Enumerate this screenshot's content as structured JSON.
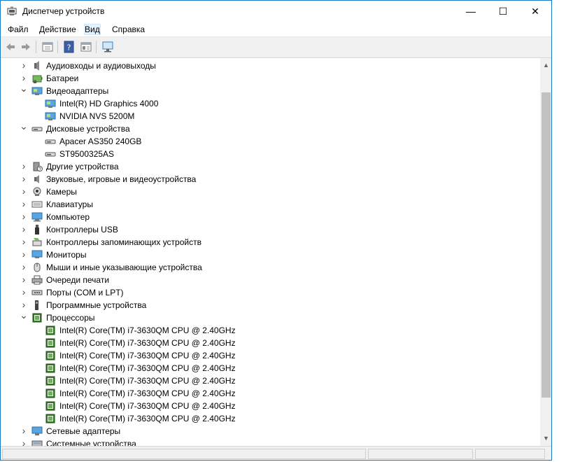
{
  "window": {
    "title": "Диспетчер устройств",
    "minimize": "—",
    "maximize": "☐",
    "close": "✕"
  },
  "menu": [
    {
      "label": "Файл"
    },
    {
      "label": "Действие"
    },
    {
      "label": "Вид"
    },
    {
      "label": "Справка"
    }
  ],
  "toolbar": {
    "buttons": [
      "back-icon",
      "forward-icon",
      "properties-icon",
      "help-icon",
      "view-icon",
      "scan-hardware-icon"
    ]
  },
  "tree": [
    {
      "label": "Аудиовходы и аудиовыходы",
      "level": 0,
      "state": "collapsed",
      "icon": "audio-io-icon"
    },
    {
      "label": "Батареи",
      "level": 0,
      "state": "collapsed",
      "icon": "battery-icon"
    },
    {
      "label": "Видеоадаптеры",
      "level": 0,
      "state": "expanded",
      "icon": "display-adapter-icon"
    },
    {
      "label": "Intel(R) HD Graphics 4000",
      "level": 1,
      "state": "none",
      "icon": "display-adapter-icon"
    },
    {
      "label": "NVIDIA NVS 5200M",
      "level": 1,
      "state": "none",
      "icon": "display-adapter-icon"
    },
    {
      "label": "Дисковые устройства",
      "level": 0,
      "state": "expanded",
      "icon": "disk-drive-icon"
    },
    {
      "label": "Apacer AS350 240GB",
      "level": 1,
      "state": "none",
      "icon": "disk-drive-icon"
    },
    {
      "label": "ST9500325AS",
      "level": 1,
      "state": "none",
      "icon": "disk-drive-icon"
    },
    {
      "label": "Другие устройства",
      "level": 0,
      "state": "collapsed",
      "icon": "unknown-device-icon"
    },
    {
      "label": "Звуковые, игровые и видеоустройства",
      "level": 0,
      "state": "collapsed",
      "icon": "sound-icon"
    },
    {
      "label": "Камеры",
      "level": 0,
      "state": "collapsed",
      "icon": "camera-icon"
    },
    {
      "label": "Клавиатуры",
      "level": 0,
      "state": "collapsed",
      "icon": "keyboard-icon"
    },
    {
      "label": "Компьютер",
      "level": 0,
      "state": "collapsed",
      "icon": "computer-icon"
    },
    {
      "label": "Контроллеры USB",
      "level": 0,
      "state": "collapsed",
      "icon": "usb-icon"
    },
    {
      "label": "Контроллеры запоминающих устройств",
      "level": 0,
      "state": "collapsed",
      "icon": "storage-controller-icon"
    },
    {
      "label": "Мониторы",
      "level": 0,
      "state": "collapsed",
      "icon": "monitor-icon"
    },
    {
      "label": "Мыши и иные указывающие устройства",
      "level": 0,
      "state": "collapsed",
      "icon": "mouse-icon"
    },
    {
      "label": "Очереди печати",
      "level": 0,
      "state": "collapsed",
      "icon": "printer-icon"
    },
    {
      "label": "Порты (COM и LPT)",
      "level": 0,
      "state": "collapsed",
      "icon": "port-icon"
    },
    {
      "label": "Программные устройства",
      "level": 0,
      "state": "collapsed",
      "icon": "software-device-icon"
    },
    {
      "label": "Процессоры",
      "level": 0,
      "state": "expanded",
      "icon": "processor-icon"
    },
    {
      "label": "Intel(R) Core(TM) i7-3630QM CPU @ 2.40GHz",
      "level": 1,
      "state": "none",
      "icon": "processor-icon"
    },
    {
      "label": "Intel(R) Core(TM) i7-3630QM CPU @ 2.40GHz",
      "level": 1,
      "state": "none",
      "icon": "processor-icon"
    },
    {
      "label": "Intel(R) Core(TM) i7-3630QM CPU @ 2.40GHz",
      "level": 1,
      "state": "none",
      "icon": "processor-icon"
    },
    {
      "label": "Intel(R) Core(TM) i7-3630QM CPU @ 2.40GHz",
      "level": 1,
      "state": "none",
      "icon": "processor-icon"
    },
    {
      "label": "Intel(R) Core(TM) i7-3630QM CPU @ 2.40GHz",
      "level": 1,
      "state": "none",
      "icon": "processor-icon"
    },
    {
      "label": "Intel(R) Core(TM) i7-3630QM CPU @ 2.40GHz",
      "level": 1,
      "state": "none",
      "icon": "processor-icon"
    },
    {
      "label": "Intel(R) Core(TM) i7-3630QM CPU @ 2.40GHz",
      "level": 1,
      "state": "none",
      "icon": "processor-icon"
    },
    {
      "label": "Intel(R) Core(TM) i7-3630QM CPU @ 2.40GHz",
      "level": 1,
      "state": "none",
      "icon": "processor-icon"
    },
    {
      "label": "Сетевые адаптеры",
      "level": 0,
      "state": "collapsed",
      "icon": "network-adapter-icon"
    },
    {
      "label": "Системные устройства",
      "level": 0,
      "state": "collapsed",
      "icon": "system-device-icon"
    }
  ],
  "colors": {
    "accent": "#1979ca",
    "processor": "#3c7a2e",
    "monitor_screen": "#5aa6e0"
  }
}
